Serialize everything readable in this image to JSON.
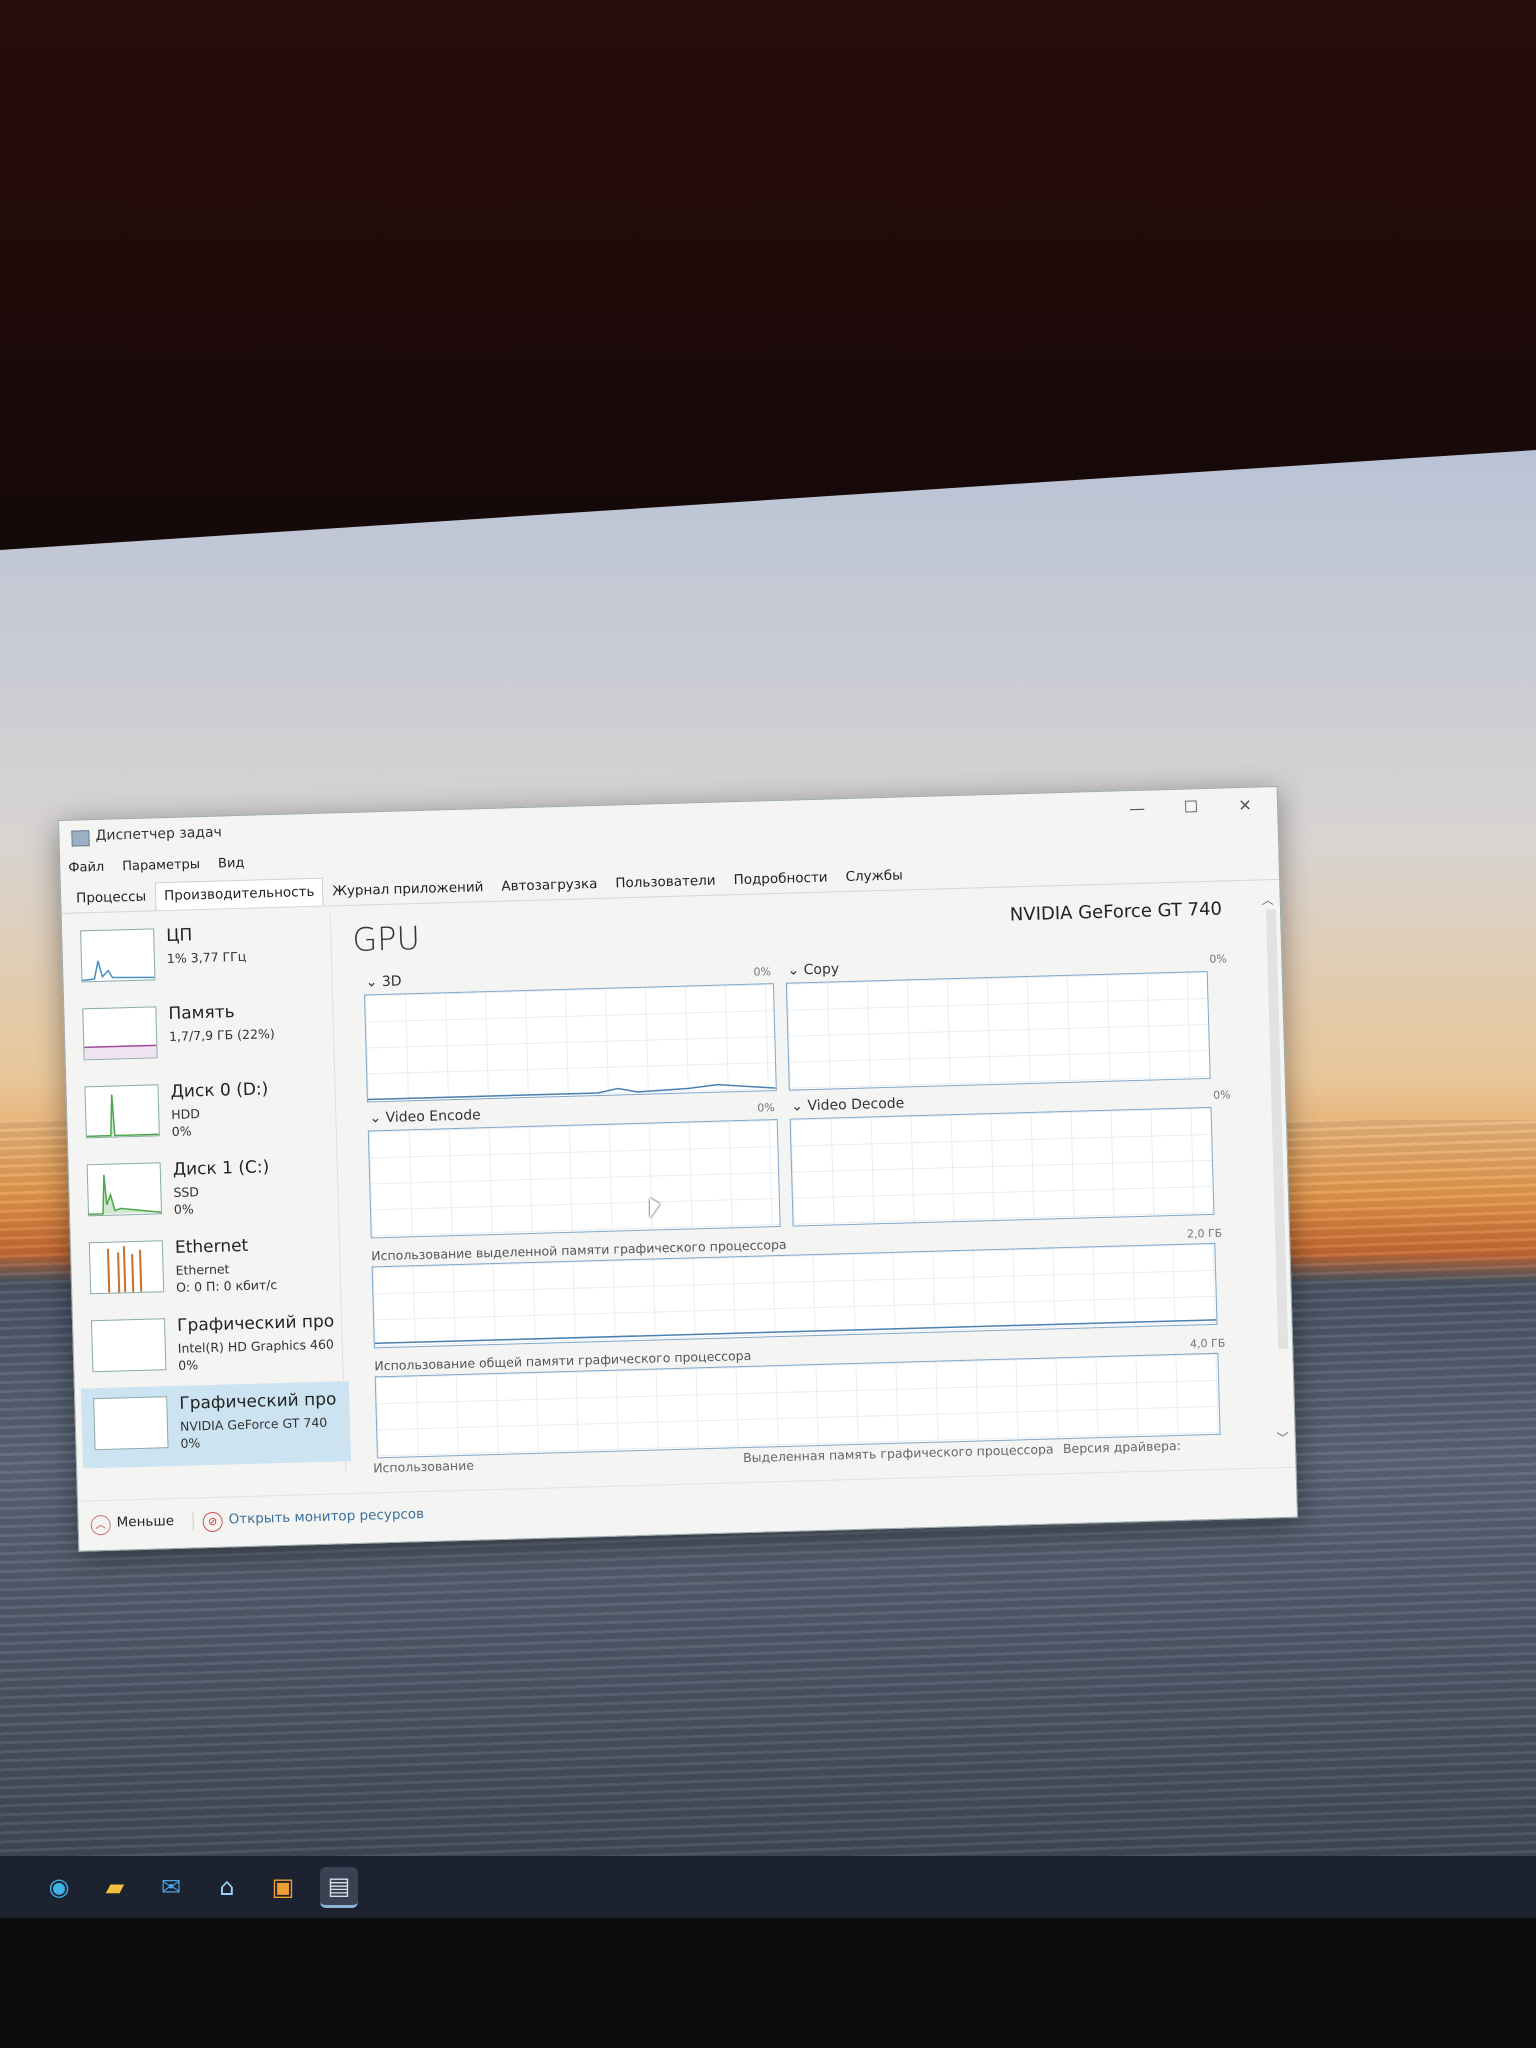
{
  "window": {
    "title": "Диспетчер задач",
    "min_glyph": "—",
    "max_glyph": "☐",
    "close_glyph": "✕"
  },
  "menu": [
    "Файл",
    "Параметры",
    "Вид"
  ],
  "tabs": [
    "Процессы",
    "Производительность",
    "Журнал приложений",
    "Автозагрузка",
    "Пользователи",
    "Подробности",
    "Службы"
  ],
  "active_tab": "Производительность",
  "sidebar": [
    {
      "name": "ЦП",
      "sub1": "1% 3,77 ГГц",
      "sub2": "",
      "sub3": "",
      "graph_color": "#4a90c8"
    },
    {
      "name": "Память",
      "sub1": "1,7/7,9 ГБ (22%)",
      "sub2": "",
      "sub3": "",
      "graph_color": "#9b4a9b"
    },
    {
      "name": "Диск 0 (D:)",
      "sub1": "HDD",
      "sub2": "0%",
      "sub3": "",
      "graph_color": "#4aa84a"
    },
    {
      "name": "Диск 1 (C:)",
      "sub1": "SSD",
      "sub2": "0%",
      "sub3": "",
      "graph_color": "#4aa84a"
    },
    {
      "name": "Ethernet",
      "sub1": "Ethernet",
      "sub2": "О: 0 П: 0 кбит/с",
      "sub3": "",
      "graph_color": "#c8702a"
    },
    {
      "name": "Графический про",
      "sub1": "Intel(R) HD Graphics 460",
      "sub2": "0%",
      "sub3": "",
      "graph_color": "#4a90c8"
    },
    {
      "name": "Графический про",
      "sub1": "NVIDIA GeForce GT 740",
      "sub2": "0%",
      "sub3": "",
      "graph_color": "#4a90c8"
    }
  ],
  "selected_sidebar_index": 6,
  "main": {
    "title": "GPU",
    "model": "NVIDIA GeForce GT 740",
    "graphs": [
      {
        "label": "3D",
        "pct": "0%"
      },
      {
        "label": "Copy",
        "pct": "0%"
      },
      {
        "label": "Video Encode",
        "pct": "0%"
      },
      {
        "label": "Video Decode",
        "pct": "0%"
      }
    ],
    "dedicated_label": "Использование выделенной памяти графического процессора",
    "dedicated_max": "2,0 ГБ",
    "shared_label": "Использование общей памяти графического процессора",
    "shared_max": "4,0 ГБ",
    "stat_usage": "Использование",
    "stat_dedicated": "Выделенная память графического процессора",
    "stat_driver": "Версия драйвера:"
  },
  "footer": {
    "less": "Меньше",
    "monitor": "Открыть монитор ресурсов"
  },
  "taskbar_icons": [
    "edge-icon",
    "folder-icon",
    "mail-icon",
    "support-icon",
    "store-icon",
    "task-manager-icon"
  ]
}
